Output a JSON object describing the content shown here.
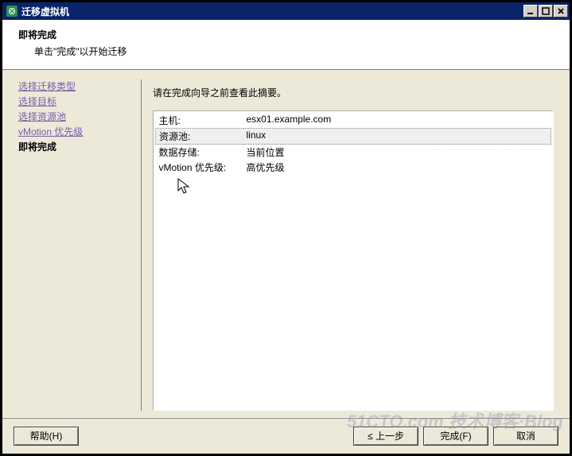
{
  "window": {
    "title": "迁移虚拟机"
  },
  "banner": {
    "title": "即将完成",
    "subtitle": "单击\"完成\"以开始迁移"
  },
  "sidebar": {
    "items": [
      {
        "label": "选择迁移类型"
      },
      {
        "label": "选择目标"
      },
      {
        "label": "选择资源池"
      },
      {
        "label": "vMotion 优先级"
      }
    ],
    "current": "即将完成"
  },
  "content": {
    "prompt": "请在完成向导之前查看此摘要。",
    "summary": [
      {
        "label": "主机:",
        "value": "esx01.example.com",
        "hl": false
      },
      {
        "label": "资源池:",
        "value": "linux",
        "hl": true
      },
      {
        "label": "数据存储:",
        "value": "当前位置",
        "hl": false
      },
      {
        "label": "vMotion 优先级:",
        "value": "高优先级",
        "hl": false
      }
    ]
  },
  "buttons": {
    "help": "帮助(H)",
    "back": "≤ 上一步",
    "finish": "完成(F)",
    "cancel": "取消"
  },
  "watermark": "51CTO.com 技术博客·Blog"
}
